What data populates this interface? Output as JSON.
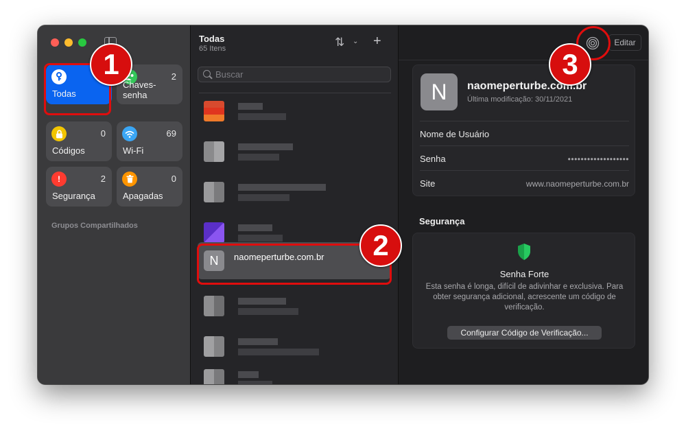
{
  "sidebar": {
    "tiles": [
      {
        "label": "Todas",
        "count": "",
        "icon": "key-icon",
        "color": "#ffffff"
      },
      {
        "label": "Chaves-senha",
        "count": "2",
        "icon": "people-icon",
        "color": "#34c759"
      },
      {
        "label": "Códigos",
        "count": "0",
        "icon": "lock-icon",
        "color": "#f2c500"
      },
      {
        "label": "Wi-Fi",
        "count": "69",
        "icon": "wifi-icon",
        "color": "#3aa6f5"
      },
      {
        "label": "Segurança",
        "count": "2",
        "icon": "alert-icon",
        "color": "#ff3b30"
      },
      {
        "label": "Apagadas",
        "count": "0",
        "icon": "trash-icon",
        "color": "#ff9500"
      }
    ],
    "section_title": "Grupos Compartilhados"
  },
  "list": {
    "title": "Todas",
    "subtitle": "65 Itens",
    "search_placeholder": "Buscar",
    "selected_item": {
      "letter": "N",
      "name": "naomeperturbe.com.br"
    }
  },
  "detail": {
    "edit_label": "Editar",
    "icon_letter": "N",
    "site_title": "naomeperturbe.com.br",
    "modified": "Última modificação: 30/11/2021",
    "rows": [
      {
        "key": "Nome de Usuário",
        "value": ""
      },
      {
        "key": "Senha",
        "value": "•••••••••••••••••••"
      },
      {
        "key": "Site",
        "value": "www.naomeperturbe.com.br"
      }
    ],
    "security_label": "Segurança",
    "strength_title": "Senha Forte",
    "strength_desc": "Esta senha é longa, difícil de adivinhar e exclusiva. Para obter segurança adicional, acrescente um código de verificação.",
    "config_button": "Configurar Código de Verificação..."
  },
  "annotations": {
    "badge1": "1",
    "badge2": "2",
    "badge3": "3",
    "color": "#d70e0e"
  }
}
